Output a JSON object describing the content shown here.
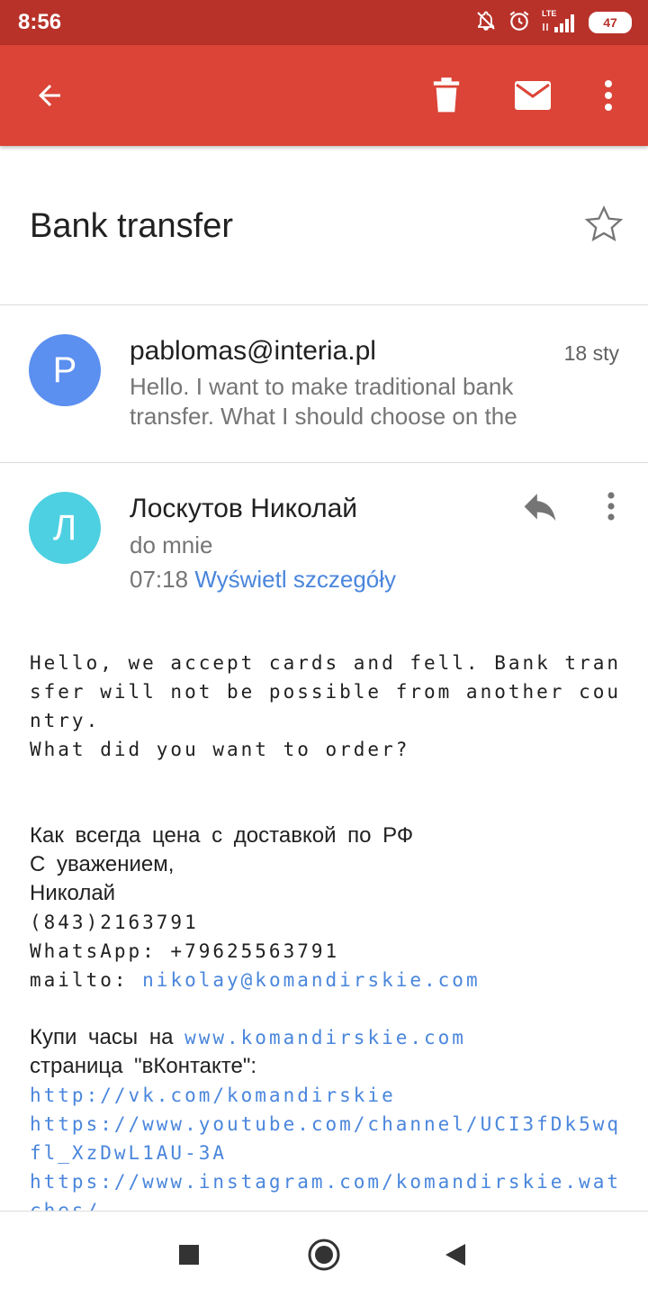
{
  "status_bar": {
    "time": "8:56",
    "network": "LTE",
    "battery": "47"
  },
  "toolbar": {
    "back_icon": "arrow-back-icon",
    "delete_icon": "trash-icon",
    "mark_unread_icon": "mail-icon",
    "more_icon": "more-vert-icon"
  },
  "subject": "Bank transfer",
  "messages": [
    {
      "avatar_letter": "P",
      "avatar_color": "#5b8ff0",
      "sender": "pablomas@interia.pl",
      "date": "18 sty",
      "snippet": "Hello. I want to make traditional bank transfer. What I should choose on the"
    },
    {
      "avatar_letter": "Л",
      "avatar_color": "#4dd0e1",
      "sender": "Лоскутов Николай",
      "to": "do mnie",
      "time": "07:18",
      "details_link": "Wyświetl szczegóły",
      "body": {
        "para1": "Hello, we accept cards and fell. Bank transfer will not be possible from another country.",
        "para2": "What did you want to order?",
        "sig_line1": "Как всегда цена с доставкой по РФ",
        "sig_line2": "С уважением,",
        "sig_line3": "Николай",
        "phone": "(843)2163791",
        "whatsapp": "WhatsApp: +79625563791",
        "mailto_label": "mailto: ",
        "mailto_link": "nikolay@komandirskie.com",
        "buy_label": "Купи часы на ",
        "buy_link": "www.komandirskie.com",
        "vk_label": "страница \"вКонтакте\":",
        "link_vk": "http://vk.com/komandirskie",
        "link_youtube": "https://www.youtube.com/channel/UCI3fDk5wqfl_XzDwL1AU-3A",
        "link_instagram": "https://www.instagram.com/komandirskie.watches/"
      }
    }
  ]
}
